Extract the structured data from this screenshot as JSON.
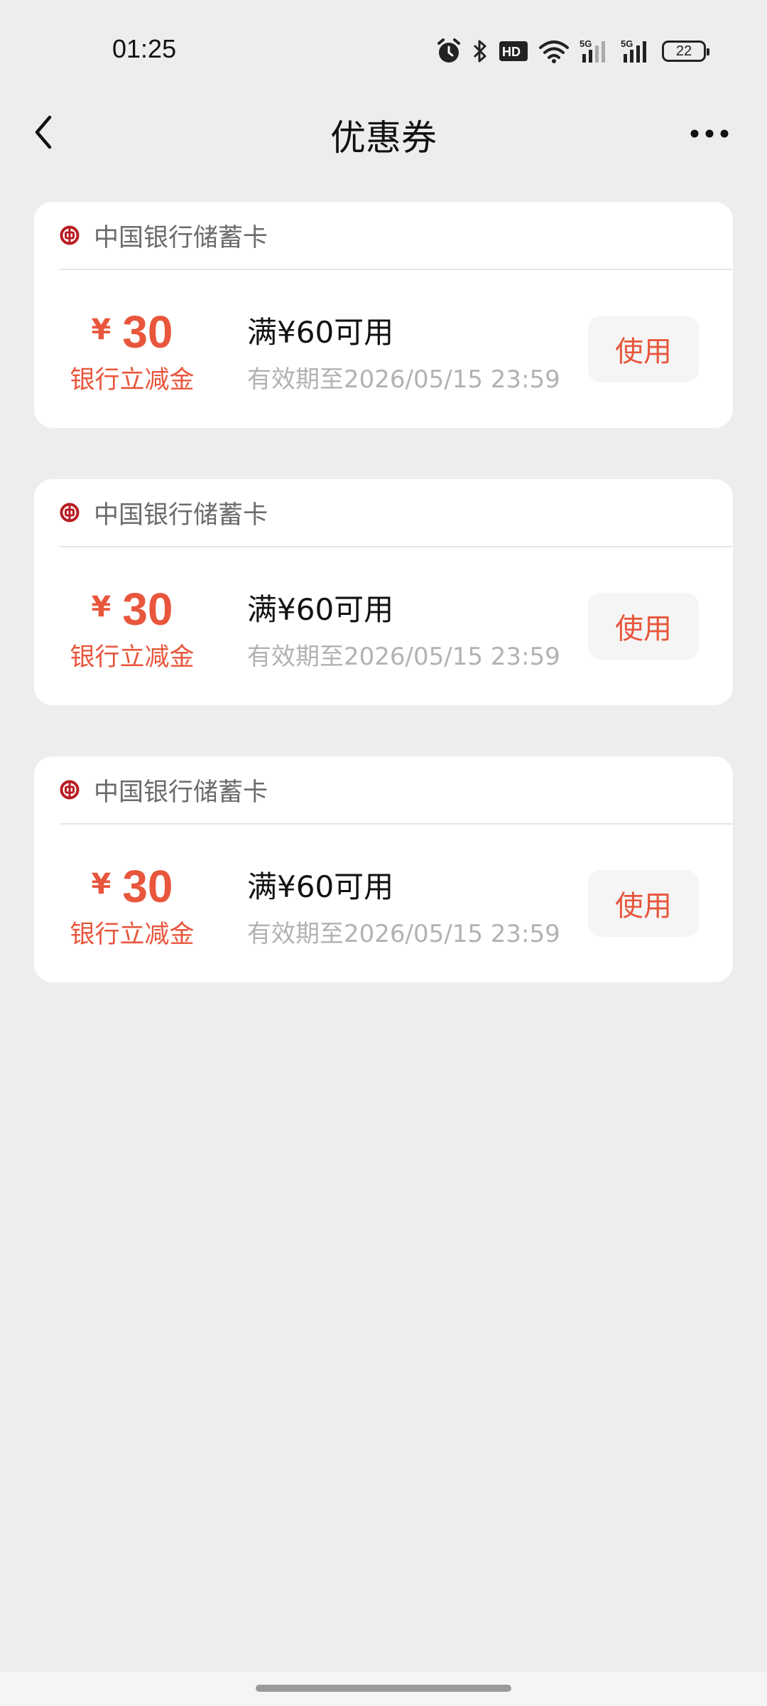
{
  "status_bar": {
    "time": "01:25",
    "battery": "22",
    "icons": [
      "alarm-icon",
      "bluetooth-icon",
      "hd-voice-icon",
      "wifi-icon",
      "signal-5g-icon",
      "signal-5g-icon",
      "battery-icon"
    ]
  },
  "header": {
    "title": "优惠券",
    "back_icon": "chevron-left-icon",
    "more_icon": "more-dots-icon"
  },
  "coupons": [
    {
      "bank": "中国银行储蓄卡",
      "currency": "¥",
      "amount": "30",
      "amount_label": "银行立减金",
      "condition": "满¥60可用",
      "validity": "有效期至2026/05/15 23:59",
      "button": "使用"
    },
    {
      "bank": "中国银行储蓄卡",
      "currency": "¥",
      "amount": "30",
      "amount_label": "银行立减金",
      "condition": "满¥60可用",
      "validity": "有效期至2026/05/15 23:59",
      "button": "使用"
    },
    {
      "bank": "中国银行储蓄卡",
      "currency": "¥",
      "amount": "30",
      "amount_label": "银行立减金",
      "condition": "满¥60可用",
      "validity": "有效期至2026/05/15 23:59",
      "button": "使用"
    }
  ],
  "colors": {
    "accent": "#e8563c",
    "bank_logo": "#b81c22",
    "background": "#ededed"
  }
}
